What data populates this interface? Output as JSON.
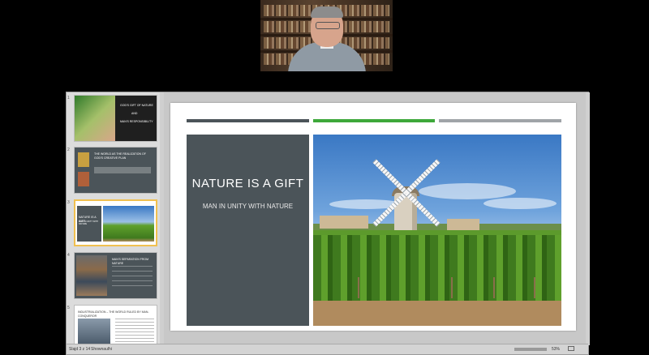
{
  "slide": {
    "title": "NATURE IS A GIFT",
    "subtitle": "MAN IN UNITY WITH NATURE",
    "bars": [
      "#4b5459",
      "#3da83a",
      "#a0a4a8"
    ],
    "panel_color": "#4b5459"
  },
  "thumbnails": [
    {
      "number": "1",
      "lines": [
        "GOD'S GIFT OF NATURE",
        "AND",
        "MAN'S RESPONSIBILITY"
      ]
    },
    {
      "number": "2",
      "lines": [
        "THE WORLD AS THE REALIZATION OF",
        "GOD'S CREATIVE PLAN"
      ]
    },
    {
      "number": "3",
      "lines": [
        "NATURE IS A GIFT",
        "MAN IN UNITY WITH NATURE"
      ]
    },
    {
      "number": "4",
      "lines": [
        "MAN'S SEPARATION FROM NATURE"
      ]
    },
    {
      "number": "5",
      "lines": [
        "INDUSTRIALIZATION – THE WORLD RULED BY MAN-CONQUEROR"
      ]
    }
  ],
  "status": {
    "slide_indicator": "Slajd 3 z 14",
    "language": "Shownaulhi",
    "zoom": "53%"
  },
  "colors": {
    "selected_border": "#f0c050",
    "accent_green": "#3da83a"
  }
}
